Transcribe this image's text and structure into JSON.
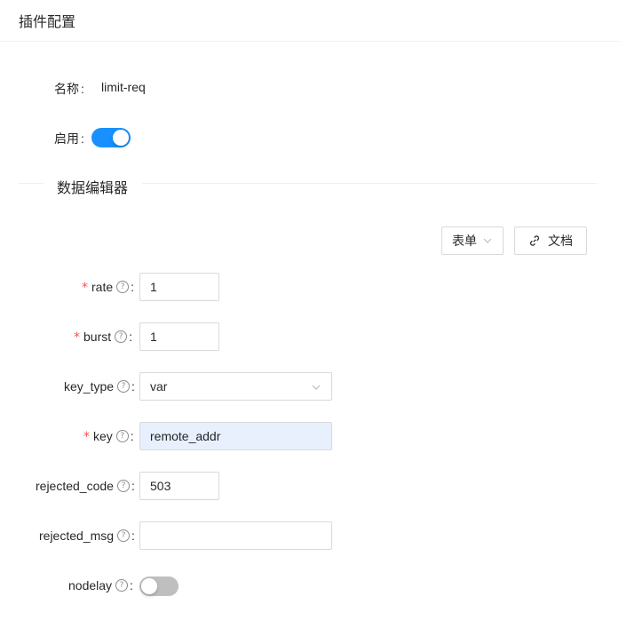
{
  "header": {
    "title": "插件配置"
  },
  "basic": {
    "name_label": "名称",
    "name_value": "limit-req",
    "enable_label": "启用",
    "enabled": true
  },
  "section": {
    "title": "数据编辑器"
  },
  "toolbar": {
    "form_label": "表单",
    "docs_label": "文档"
  },
  "colon": ":",
  "required_mark": "*",
  "help_glyph": "?",
  "fields": {
    "rate": {
      "label": "rate",
      "required": true,
      "value": "1"
    },
    "burst": {
      "label": "burst",
      "required": true,
      "value": "1"
    },
    "key_type": {
      "label": "key_type",
      "required": false,
      "value": "var"
    },
    "key": {
      "label": "key",
      "required": true,
      "value": "remote_addr"
    },
    "rejected_code": {
      "label": "rejected_code",
      "required": false,
      "value": "503"
    },
    "rejected_msg": {
      "label": "rejected_msg",
      "required": false,
      "value": ""
    },
    "nodelay": {
      "label": "nodelay",
      "required": false,
      "enabled": false
    }
  },
  "colors": {
    "primary": "#1890ff",
    "required": "#ff4d4f",
    "autofill": "#e8f0fe"
  }
}
